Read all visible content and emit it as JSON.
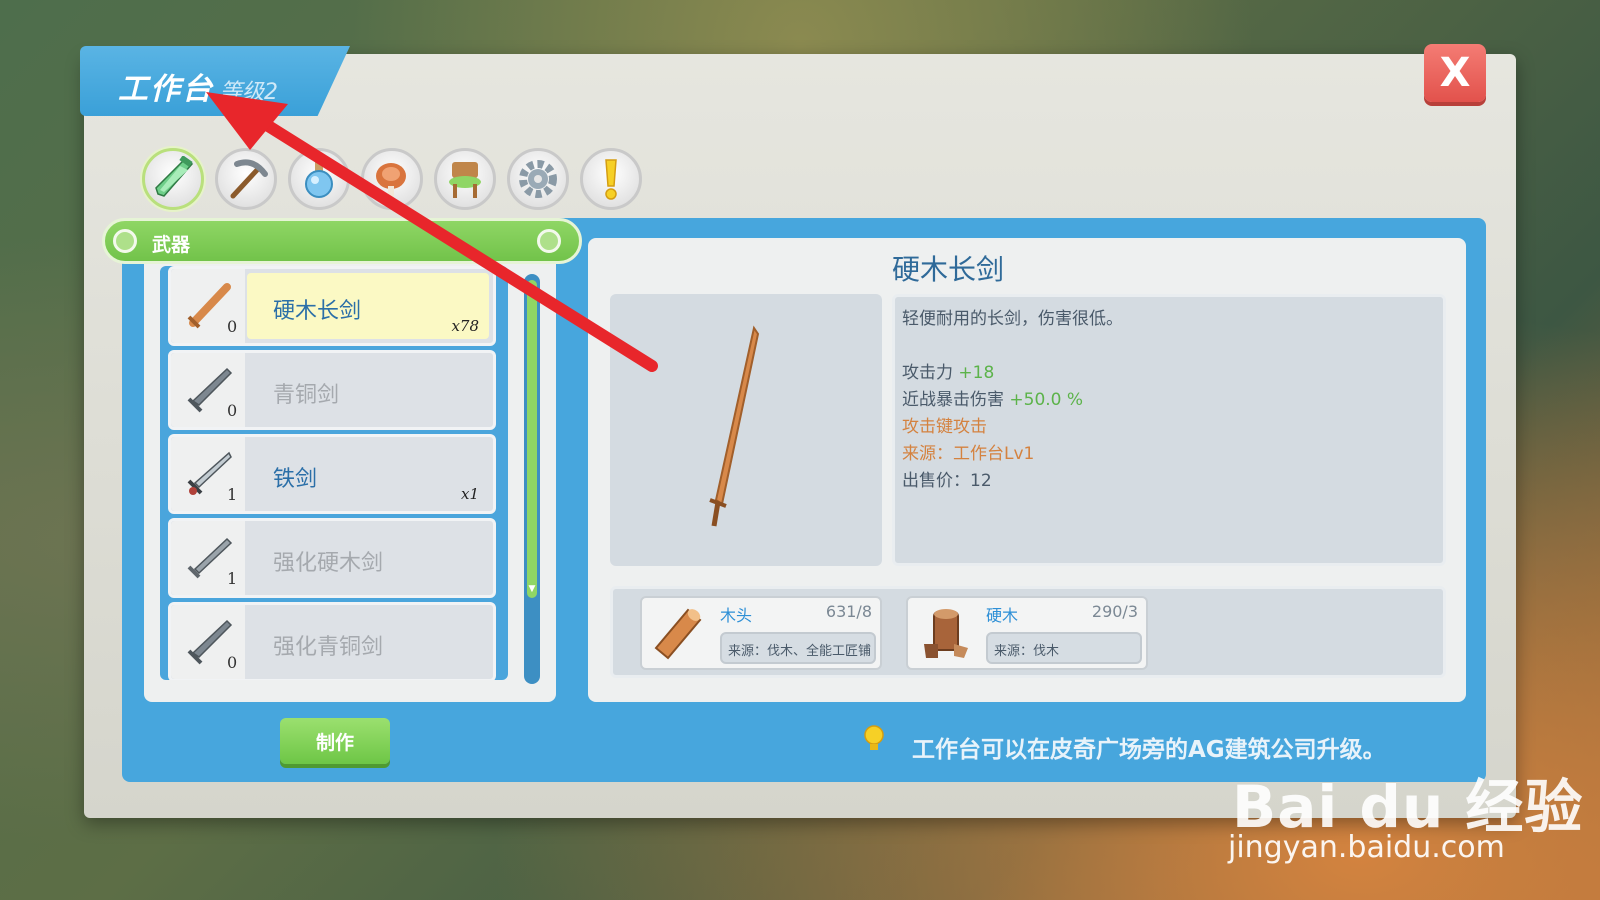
{
  "window": {
    "title": "工作台",
    "level": "等级2",
    "close_label": "X"
  },
  "category_tabs": [
    {
      "name": "weapon-tab",
      "icon": "sword-icon",
      "active": true
    },
    {
      "name": "tool-tab",
      "icon": "pickaxe-icon",
      "active": false
    },
    {
      "name": "potion-tab",
      "icon": "potion-icon",
      "active": false
    },
    {
      "name": "food-tab",
      "icon": "meat-icon",
      "active": false
    },
    {
      "name": "furniture-tab",
      "icon": "chair-icon",
      "active": false
    },
    {
      "name": "parts-tab",
      "icon": "gear-icon",
      "active": false
    },
    {
      "name": "misc-tab",
      "icon": "exclamation-icon",
      "active": false
    }
  ],
  "category": {
    "label": "武器"
  },
  "items": [
    {
      "name": "硬木长剑",
      "count": "0",
      "owned": "x78",
      "available": true,
      "selected": true
    },
    {
      "name": "青铜剑",
      "count": "0",
      "owned": "",
      "available": false,
      "selected": false
    },
    {
      "name": "铁剑",
      "count": "1",
      "owned": "x1",
      "available": true,
      "selected": false
    },
    {
      "name": "强化硬木剑",
      "count": "1",
      "owned": "",
      "available": false,
      "selected": false
    },
    {
      "name": "强化青铜剑",
      "count": "0",
      "owned": "",
      "available": false,
      "selected": false
    }
  ],
  "craft_button": "制作",
  "detail": {
    "title": "硬木长剑",
    "description": "轻便耐用的长剑，伤害很低。",
    "attack_label": "攻击力",
    "attack_value": "+18",
    "crit_label": "近战暴击伤害",
    "crit_value": "+50.0 %",
    "attack_key": "攻击键攻击",
    "source": "来源：工作台Lv1",
    "price": "出售价：12"
  },
  "materials": [
    {
      "name": "木头",
      "qty": "631/8",
      "source": "来源：伐木、全能工匠铺",
      "icon": "log-icon"
    },
    {
      "name": "硬木",
      "qty": "290/3",
      "source": "来源：伐木",
      "icon": "hardwood-icon"
    }
  ],
  "tip": {
    "icon": "lightbulb-icon",
    "text": "工作台可以在皮奇广场旁的AG建筑公司升级。"
  },
  "watermark": {
    "logo": "Bai du 经验",
    "url": "jingyan.baidu.com"
  },
  "colors": {
    "accent_blue": "#47a6dd",
    "accent_green": "#72c34a",
    "close_red": "#e2524c",
    "annotation_arrow": "#e8262b"
  }
}
